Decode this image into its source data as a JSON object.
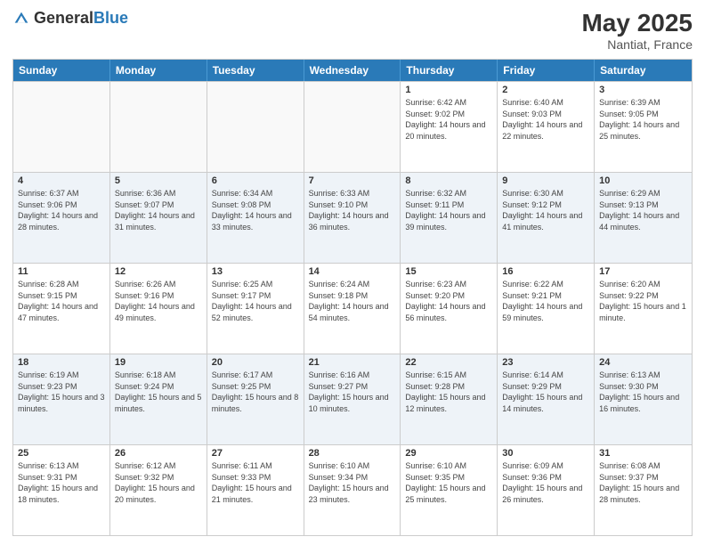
{
  "header": {
    "logo_general": "General",
    "logo_blue": "Blue",
    "month": "May 2025",
    "location": "Nantiat, France"
  },
  "days_of_week": [
    "Sunday",
    "Monday",
    "Tuesday",
    "Wednesday",
    "Thursday",
    "Friday",
    "Saturday"
  ],
  "weeks": [
    [
      {
        "day": "",
        "sunrise": "",
        "sunset": "",
        "daylight": "",
        "empty": true
      },
      {
        "day": "",
        "sunrise": "",
        "sunset": "",
        "daylight": "",
        "empty": true
      },
      {
        "day": "",
        "sunrise": "",
        "sunset": "",
        "daylight": "",
        "empty": true
      },
      {
        "day": "",
        "sunrise": "",
        "sunset": "",
        "daylight": "",
        "empty": true
      },
      {
        "day": "1",
        "sunrise": "Sunrise: 6:42 AM",
        "sunset": "Sunset: 9:02 PM",
        "daylight": "Daylight: 14 hours and 20 minutes.",
        "empty": false
      },
      {
        "day": "2",
        "sunrise": "Sunrise: 6:40 AM",
        "sunset": "Sunset: 9:03 PM",
        "daylight": "Daylight: 14 hours and 22 minutes.",
        "empty": false
      },
      {
        "day": "3",
        "sunrise": "Sunrise: 6:39 AM",
        "sunset": "Sunset: 9:05 PM",
        "daylight": "Daylight: 14 hours and 25 minutes.",
        "empty": false
      }
    ],
    [
      {
        "day": "4",
        "sunrise": "Sunrise: 6:37 AM",
        "sunset": "Sunset: 9:06 PM",
        "daylight": "Daylight: 14 hours and 28 minutes.",
        "empty": false
      },
      {
        "day": "5",
        "sunrise": "Sunrise: 6:36 AM",
        "sunset": "Sunset: 9:07 PM",
        "daylight": "Daylight: 14 hours and 31 minutes.",
        "empty": false
      },
      {
        "day": "6",
        "sunrise": "Sunrise: 6:34 AM",
        "sunset": "Sunset: 9:08 PM",
        "daylight": "Daylight: 14 hours and 33 minutes.",
        "empty": false
      },
      {
        "day": "7",
        "sunrise": "Sunrise: 6:33 AM",
        "sunset": "Sunset: 9:10 PM",
        "daylight": "Daylight: 14 hours and 36 minutes.",
        "empty": false
      },
      {
        "day": "8",
        "sunrise": "Sunrise: 6:32 AM",
        "sunset": "Sunset: 9:11 PM",
        "daylight": "Daylight: 14 hours and 39 minutes.",
        "empty": false
      },
      {
        "day": "9",
        "sunrise": "Sunrise: 6:30 AM",
        "sunset": "Sunset: 9:12 PM",
        "daylight": "Daylight: 14 hours and 41 minutes.",
        "empty": false
      },
      {
        "day": "10",
        "sunrise": "Sunrise: 6:29 AM",
        "sunset": "Sunset: 9:13 PM",
        "daylight": "Daylight: 14 hours and 44 minutes.",
        "empty": false
      }
    ],
    [
      {
        "day": "11",
        "sunrise": "Sunrise: 6:28 AM",
        "sunset": "Sunset: 9:15 PM",
        "daylight": "Daylight: 14 hours and 47 minutes.",
        "empty": false
      },
      {
        "day": "12",
        "sunrise": "Sunrise: 6:26 AM",
        "sunset": "Sunset: 9:16 PM",
        "daylight": "Daylight: 14 hours and 49 minutes.",
        "empty": false
      },
      {
        "day": "13",
        "sunrise": "Sunrise: 6:25 AM",
        "sunset": "Sunset: 9:17 PM",
        "daylight": "Daylight: 14 hours and 52 minutes.",
        "empty": false
      },
      {
        "day": "14",
        "sunrise": "Sunrise: 6:24 AM",
        "sunset": "Sunset: 9:18 PM",
        "daylight": "Daylight: 14 hours and 54 minutes.",
        "empty": false
      },
      {
        "day": "15",
        "sunrise": "Sunrise: 6:23 AM",
        "sunset": "Sunset: 9:20 PM",
        "daylight": "Daylight: 14 hours and 56 minutes.",
        "empty": false
      },
      {
        "day": "16",
        "sunrise": "Sunrise: 6:22 AM",
        "sunset": "Sunset: 9:21 PM",
        "daylight": "Daylight: 14 hours and 59 minutes.",
        "empty": false
      },
      {
        "day": "17",
        "sunrise": "Sunrise: 6:20 AM",
        "sunset": "Sunset: 9:22 PM",
        "daylight": "Daylight: 15 hours and 1 minute.",
        "empty": false
      }
    ],
    [
      {
        "day": "18",
        "sunrise": "Sunrise: 6:19 AM",
        "sunset": "Sunset: 9:23 PM",
        "daylight": "Daylight: 15 hours and 3 minutes.",
        "empty": false
      },
      {
        "day": "19",
        "sunrise": "Sunrise: 6:18 AM",
        "sunset": "Sunset: 9:24 PM",
        "daylight": "Daylight: 15 hours and 5 minutes.",
        "empty": false
      },
      {
        "day": "20",
        "sunrise": "Sunrise: 6:17 AM",
        "sunset": "Sunset: 9:25 PM",
        "daylight": "Daylight: 15 hours and 8 minutes.",
        "empty": false
      },
      {
        "day": "21",
        "sunrise": "Sunrise: 6:16 AM",
        "sunset": "Sunset: 9:27 PM",
        "daylight": "Daylight: 15 hours and 10 minutes.",
        "empty": false
      },
      {
        "day": "22",
        "sunrise": "Sunrise: 6:15 AM",
        "sunset": "Sunset: 9:28 PM",
        "daylight": "Daylight: 15 hours and 12 minutes.",
        "empty": false
      },
      {
        "day": "23",
        "sunrise": "Sunrise: 6:14 AM",
        "sunset": "Sunset: 9:29 PM",
        "daylight": "Daylight: 15 hours and 14 minutes.",
        "empty": false
      },
      {
        "day": "24",
        "sunrise": "Sunrise: 6:13 AM",
        "sunset": "Sunset: 9:30 PM",
        "daylight": "Daylight: 15 hours and 16 minutes.",
        "empty": false
      }
    ],
    [
      {
        "day": "25",
        "sunrise": "Sunrise: 6:13 AM",
        "sunset": "Sunset: 9:31 PM",
        "daylight": "Daylight: 15 hours and 18 minutes.",
        "empty": false
      },
      {
        "day": "26",
        "sunrise": "Sunrise: 6:12 AM",
        "sunset": "Sunset: 9:32 PM",
        "daylight": "Daylight: 15 hours and 20 minutes.",
        "empty": false
      },
      {
        "day": "27",
        "sunrise": "Sunrise: 6:11 AM",
        "sunset": "Sunset: 9:33 PM",
        "daylight": "Daylight: 15 hours and 21 minutes.",
        "empty": false
      },
      {
        "day": "28",
        "sunrise": "Sunrise: 6:10 AM",
        "sunset": "Sunset: 9:34 PM",
        "daylight": "Daylight: 15 hours and 23 minutes.",
        "empty": false
      },
      {
        "day": "29",
        "sunrise": "Sunrise: 6:10 AM",
        "sunset": "Sunset: 9:35 PM",
        "daylight": "Daylight: 15 hours and 25 minutes.",
        "empty": false
      },
      {
        "day": "30",
        "sunrise": "Sunrise: 6:09 AM",
        "sunset": "Sunset: 9:36 PM",
        "daylight": "Daylight: 15 hours and 26 minutes.",
        "empty": false
      },
      {
        "day": "31",
        "sunrise": "Sunrise: 6:08 AM",
        "sunset": "Sunset: 9:37 PM",
        "daylight": "Daylight: 15 hours and 28 minutes.",
        "empty": false
      }
    ]
  ]
}
